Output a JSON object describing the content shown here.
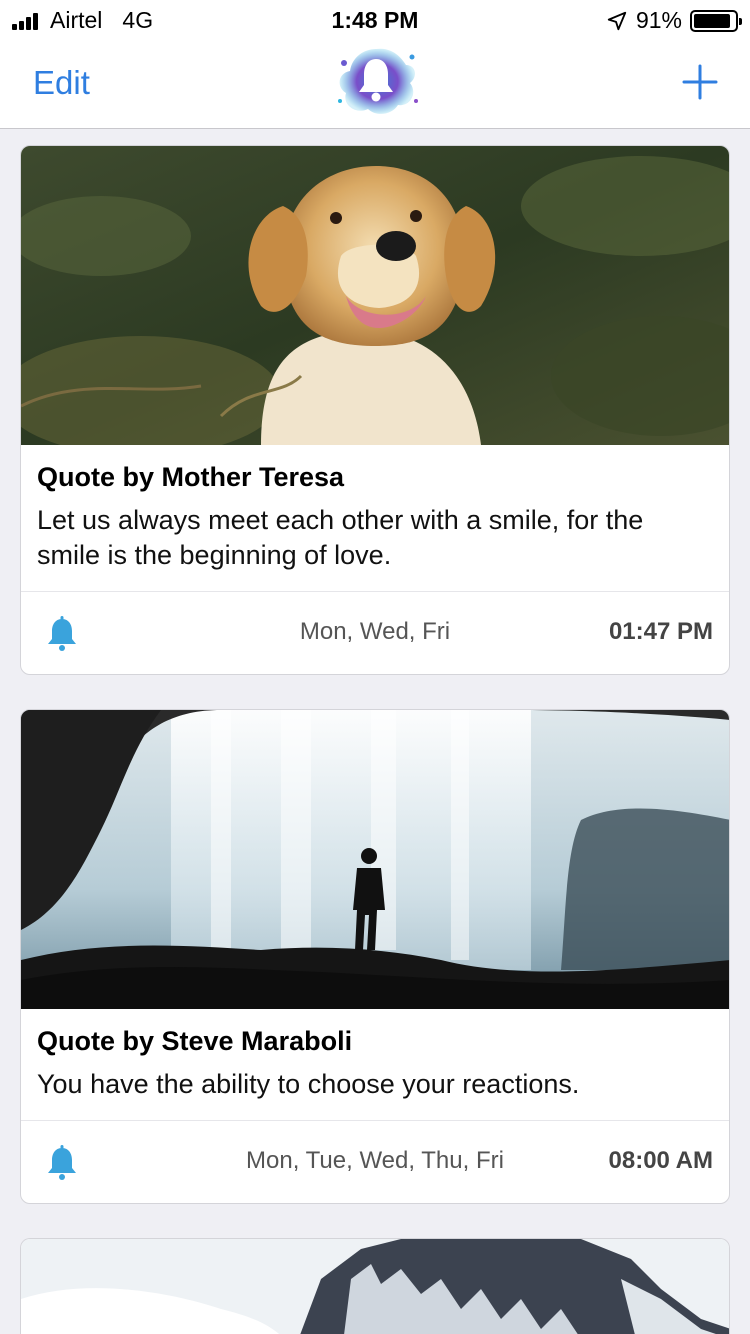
{
  "status_bar": {
    "carrier": "Airtel",
    "network": "4G",
    "time": "1:48 PM",
    "battery": "91%",
    "battery_level": 0.91
  },
  "nav": {
    "edit_label": "Edit",
    "logo_icon": "bell-splash-logo",
    "add_icon": "plus-icon",
    "accent_color": "#2f7ee0"
  },
  "reminders": [
    {
      "title": "Quote by Mother Teresa",
      "text": "Let us always meet each other with a smile, for the smile is the beginning of love.",
      "days": "Mon, Wed, Fri",
      "time": "01:47 PM",
      "image": "golden-retriever-in-forest"
    },
    {
      "title": "Quote by Steve Maraboli",
      "text": "You have the ability to choose your reactions.",
      "days": "Mon, Tue, Wed, Thu, Fri",
      "time": "08:00 AM",
      "image": "person-silhouette-waterfall-cave"
    },
    {
      "image": "snowy-mountain-peak"
    }
  ]
}
